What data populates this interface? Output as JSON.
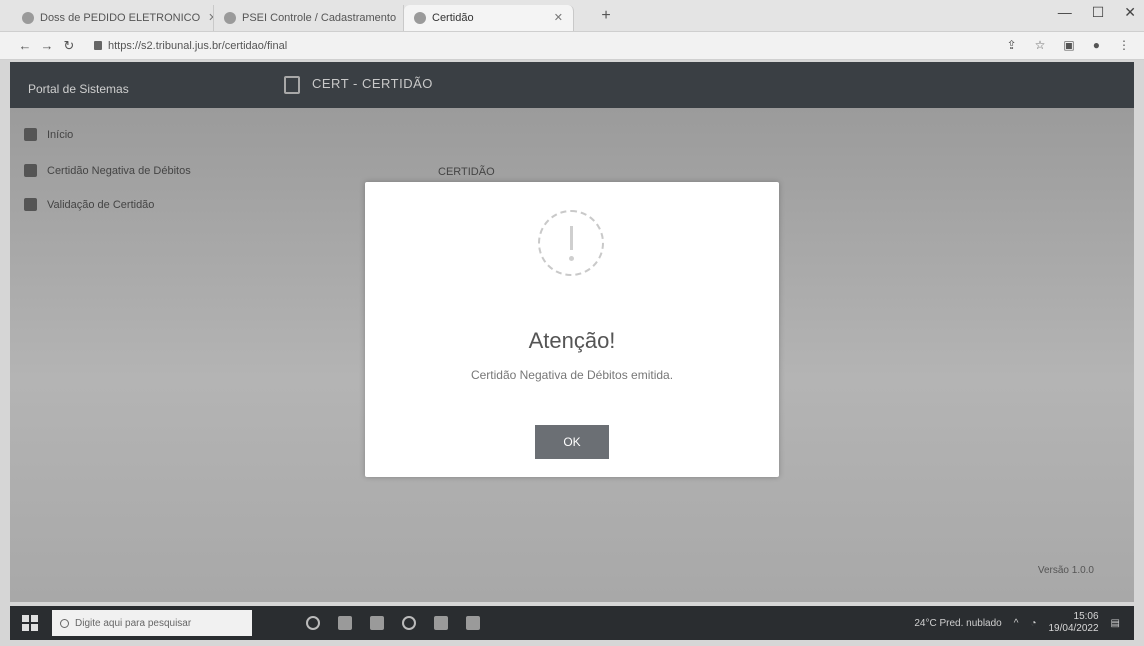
{
  "browser": {
    "tabs": [
      {
        "label": "Doss de PEDIDO ELETRONICO",
        "active": false
      },
      {
        "label": "PSEI Controle / Cadastramento",
        "active": false
      },
      {
        "label": "Certidão",
        "active": true
      }
    ],
    "url": "https://s2.tribunal.jus.br/certidao/final"
  },
  "app": {
    "brand": "Portal de Sistemas",
    "page_title": "CERT - CERTIDÃO",
    "sidebar": {
      "items": [
        {
          "label": "Início",
          "icon": "home-icon"
        },
        {
          "label": "Certidão Negativa de Débitos",
          "icon": "document-icon"
        },
        {
          "label": "Validação de Certidão",
          "icon": "check-icon"
        }
      ]
    },
    "background_label": "CERTIDÃO",
    "footer_text": "Versão 1.0.0"
  },
  "modal": {
    "title": "Atenção!",
    "message": "Certidão Negativa de Débitos emitida.",
    "ok_label": "OK",
    "icon": "warning-icon"
  },
  "taskbar": {
    "search_placeholder": "Digite aqui para pesquisar",
    "weather": "24°C Pred. nublado",
    "time": "15:06",
    "date": "19/04/2022"
  },
  "colors": {
    "header_bg": "#3a3f44",
    "modal_bg": "#ffffff",
    "button_bg": "#6b6f74",
    "taskbar_bg": "#2a2d30"
  }
}
